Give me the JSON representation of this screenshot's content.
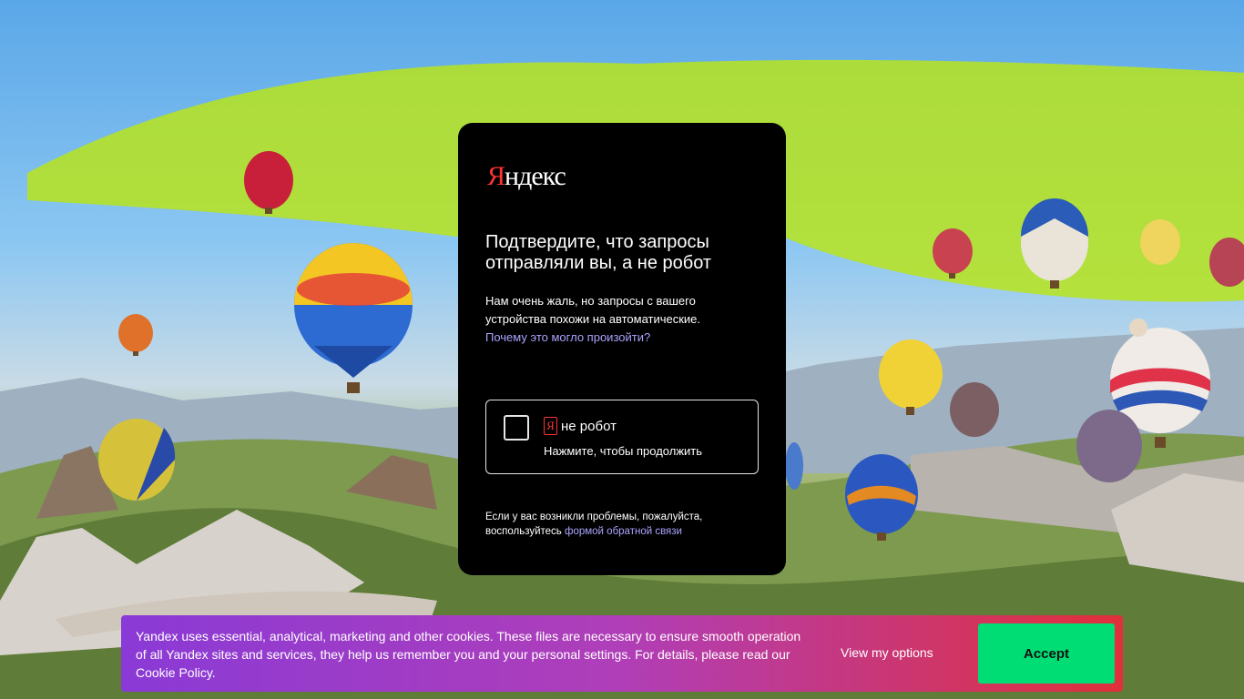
{
  "page": {
    "background_theme": "hot-air-balloons"
  },
  "card": {
    "logo_first": "Я",
    "logo_rest": "ндекс",
    "title": "Подтвердите, что запросы отправляли вы, а не робот",
    "description": "Нам очень жаль, но запросы с вашего устройства похожи на автоматические.",
    "description_link": "Почему это могло произойти?",
    "captcha": {
      "mark": "Я",
      "label": "не робот",
      "sublabel": "Нажмите, чтобы продолжить"
    },
    "help_text": "Если у вас возникли проблемы, пожалуйста, воспользуйтесь",
    "help_link": "формой обратной связи"
  },
  "cookie_banner": {
    "text": "Yandex uses essential, analytical, marketing and other cookies. These files are necessary to ensure smooth operation of all Yandex sites and services, they help us remember you and your personal settings. For details, please read our",
    "policy_link": "Cookie Policy",
    "policy_suffix": ".",
    "options_label": "View my options",
    "accept_label": "Accept"
  },
  "colors": {
    "card_bg": "#000000",
    "link": "#a9a4ff",
    "logo_accent": "#ff3333",
    "accept_bg": "#00dd74",
    "banner_gradient_start": "#8a3ad6",
    "banner_gradient_end": "#e0303a"
  }
}
